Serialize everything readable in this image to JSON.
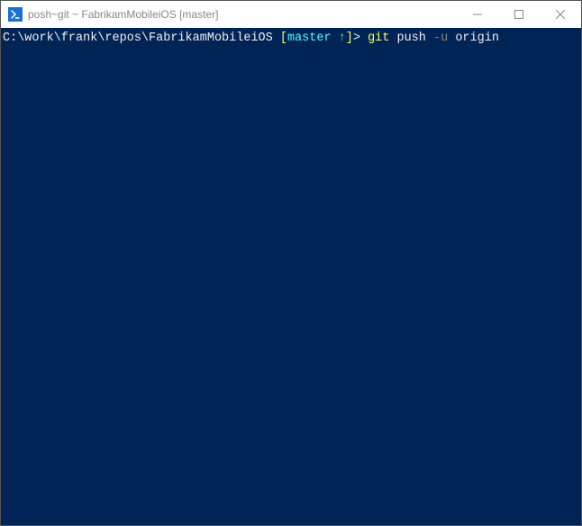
{
  "titlebar": {
    "text": "posh~git ~ FabrikamMobileiOS [master]"
  },
  "prompt": {
    "path": "C:\\work\\frank\\repos\\FabrikamMobileiOS",
    "open_bracket": " [",
    "branch": "master",
    "arrow": " ↑",
    "close_bracket": "]",
    "delimiter": ">"
  },
  "command": {
    "git": " git",
    "action": " push",
    "flag": " -u",
    "remote": " origin"
  }
}
